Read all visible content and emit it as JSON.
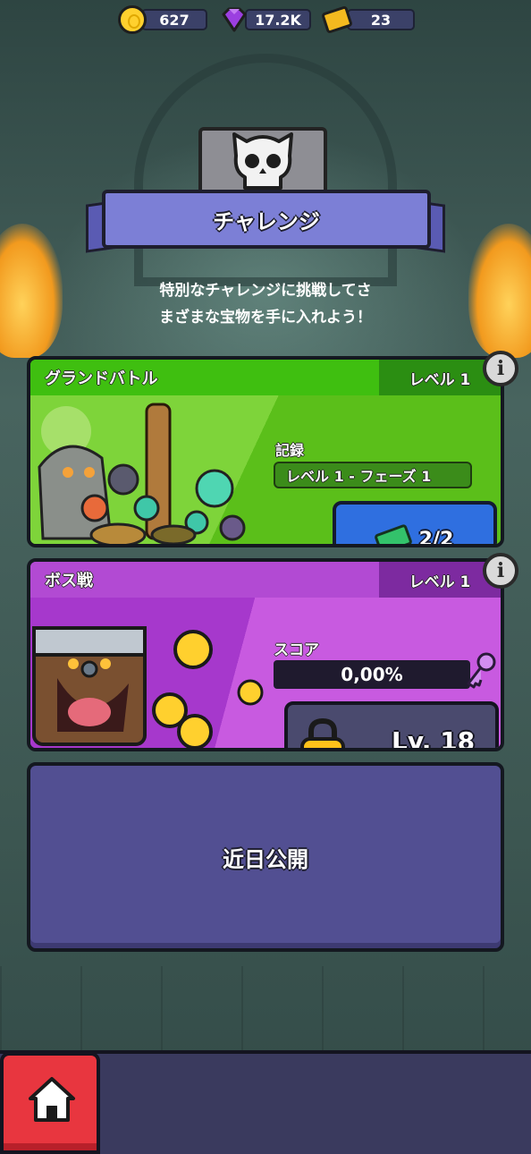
{
  "currency": {
    "coins": "627",
    "gems": "17.2K",
    "tickets": "23"
  },
  "header": {
    "title": "チャレンジ",
    "description_line1": "特別なチャレンジに挑戦してさ",
    "description_line2": "まざまな宝物を手に入れよう！"
  },
  "grand_battle": {
    "title": "グランドバトル",
    "level": "レベル 1",
    "record_label": "記録",
    "record_value": "レベル 1 - フェーズ 1",
    "ticket_count": "2/2"
  },
  "boss_battle": {
    "title": "ボス戦",
    "level": "レベル 1",
    "score_label": "スコア",
    "score_value": "0,00%",
    "unlock_level": "Lv. 18"
  },
  "coming_soon": {
    "label": "近日公開"
  },
  "colors": {
    "green_accent": "#3fbf10",
    "purple_accent": "#b24ad3",
    "home_red": "#e8363f",
    "play_blue": "#2f6fe0"
  },
  "icons": [
    "coin-icon",
    "gem-icon",
    "ticket-icon",
    "skull-icon",
    "info-icon",
    "ticket-icon",
    "key-icon",
    "padlock-icon",
    "home-icon"
  ]
}
